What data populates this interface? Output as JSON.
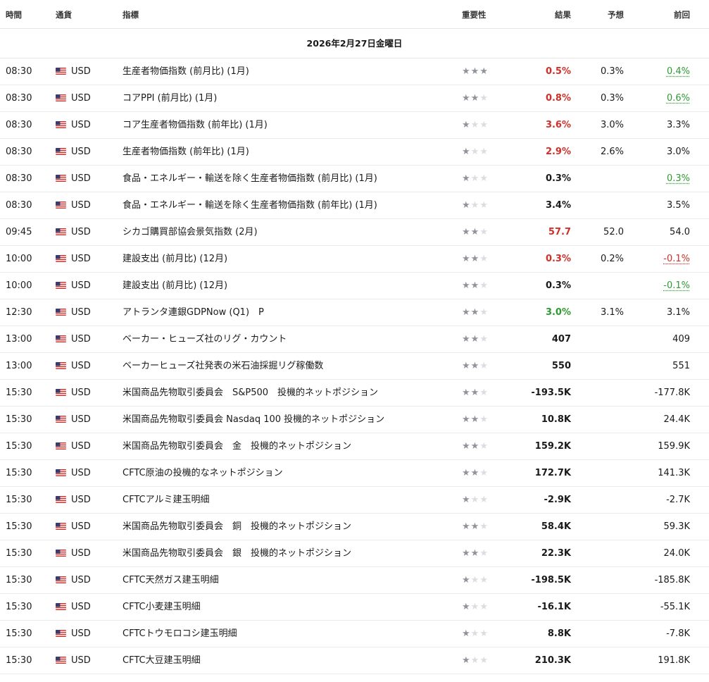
{
  "headers": {
    "time": "時間",
    "currency": "通貨",
    "indicator": "指標",
    "importance": "重要性",
    "actual": "結果",
    "forecast": "予想",
    "previous": "前回"
  },
  "date_label": "2026年2月27日金曜日",
  "colors": {
    "red": "#d0302a",
    "green": "#2e9b31",
    "star_on": "#8f939b",
    "star_off": "#dcdde0"
  },
  "events": [
    {
      "time": "08:30",
      "currency": "USD",
      "indicator": "生産者物価指数 (前月比) (1月)",
      "importance": 3,
      "actual": "0.5%",
      "actual_color": "red",
      "forecast": "0.3%",
      "previous": "0.4%",
      "previous_color": "green"
    },
    {
      "time": "08:30",
      "currency": "USD",
      "indicator": "コアPPI (前月比) (1月)",
      "importance": 2,
      "actual": "0.8%",
      "actual_color": "red",
      "forecast": "0.3%",
      "previous": "0.6%",
      "previous_color": "green"
    },
    {
      "time": "08:30",
      "currency": "USD",
      "indicator": "コア生産者物価指数 (前年比) (1月)",
      "importance": 1,
      "actual": "3.6%",
      "actual_color": "red",
      "forecast": "3.0%",
      "previous": "3.3%",
      "previous_color": ""
    },
    {
      "time": "08:30",
      "currency": "USD",
      "indicator": "生産者物価指数 (前年比) (1月)",
      "importance": 1,
      "actual": "2.9%",
      "actual_color": "red",
      "forecast": "2.6%",
      "previous": "3.0%",
      "previous_color": ""
    },
    {
      "time": "08:30",
      "currency": "USD",
      "indicator": "食品・エネルギー・輸送を除く生産者物価指数 (前月比) (1月)",
      "importance": 1,
      "actual": "0.3%",
      "actual_color": "",
      "forecast": "",
      "previous": "0.3%",
      "previous_color": "green"
    },
    {
      "time": "08:30",
      "currency": "USD",
      "indicator": "食品・エネルギー・輸送を除く生産者物価指数 (前年比) (1月)",
      "importance": 1,
      "actual": "3.4%",
      "actual_color": "",
      "forecast": "",
      "previous": "3.5%",
      "previous_color": ""
    },
    {
      "time": "09:45",
      "currency": "USD",
      "indicator": "シカゴ購買部協会景気指数 (2月)",
      "importance": 2,
      "actual": "57.7",
      "actual_color": "red",
      "forecast": "52.0",
      "previous": "54.0",
      "previous_color": ""
    },
    {
      "time": "10:00",
      "currency": "USD",
      "indicator": "建設支出 (前月比) (12月)",
      "importance": 2,
      "actual": "0.3%",
      "actual_color": "red",
      "forecast": "0.2%",
      "previous": "-0.1%",
      "previous_color": "red"
    },
    {
      "time": "10:00",
      "currency": "USD",
      "indicator": "建設支出 (前月比) (12月)",
      "importance": 2,
      "actual": "0.3%",
      "actual_color": "",
      "forecast": "",
      "previous": "-0.1%",
      "previous_color": "green"
    },
    {
      "time": "12:30",
      "currency": "USD",
      "indicator": "アトランタ連銀GDPNow (Q1)　P",
      "importance": 2,
      "actual": "3.0%",
      "actual_color": "green",
      "forecast": "3.1%",
      "previous": "3.1%",
      "previous_color": ""
    },
    {
      "time": "13:00",
      "currency": "USD",
      "indicator": "ベーカー・ヒューズ社のリグ・カウント",
      "importance": 2,
      "actual": "407",
      "actual_color": "",
      "forecast": "",
      "previous": "409",
      "previous_color": ""
    },
    {
      "time": "13:00",
      "currency": "USD",
      "indicator": "ベーカーヒューズ社発表の米石油採掘リグ稼働数",
      "importance": 2,
      "actual": "550",
      "actual_color": "",
      "forecast": "",
      "previous": "551",
      "previous_color": ""
    },
    {
      "time": "15:30",
      "currency": "USD",
      "indicator": "米国商品先物取引委員会　S&P500　投機的ネットポジション",
      "importance": 2,
      "actual": "-193.5K",
      "actual_color": "",
      "forecast": "",
      "previous": "-177.8K",
      "previous_color": ""
    },
    {
      "time": "15:30",
      "currency": "USD",
      "indicator": "米国商品先物取引委員会 Nasdaq 100 投機的ネットポジション",
      "importance": 2,
      "actual": "10.8K",
      "actual_color": "",
      "forecast": "",
      "previous": "24.4K",
      "previous_color": ""
    },
    {
      "time": "15:30",
      "currency": "USD",
      "indicator": "米国商品先物取引委員会　金　投機的ネットポジション",
      "importance": 2,
      "actual": "159.2K",
      "actual_color": "",
      "forecast": "",
      "previous": "159.9K",
      "previous_color": ""
    },
    {
      "time": "15:30",
      "currency": "USD",
      "indicator": "CFTC原油の投機的なネットポジション",
      "importance": 2,
      "actual": "172.7K",
      "actual_color": "",
      "forecast": "",
      "previous": "141.3K",
      "previous_color": ""
    },
    {
      "time": "15:30",
      "currency": "USD",
      "indicator": "CFTCアルミ建玉明細",
      "importance": 1,
      "actual": "-2.9K",
      "actual_color": "",
      "forecast": "",
      "previous": "-2.7K",
      "previous_color": ""
    },
    {
      "time": "15:30",
      "currency": "USD",
      "indicator": "米国商品先物取引委員会　銅　投機的ネットポジション",
      "importance": 2,
      "actual": "58.4K",
      "actual_color": "",
      "forecast": "",
      "previous": "59.3K",
      "previous_color": ""
    },
    {
      "time": "15:30",
      "currency": "USD",
      "indicator": "米国商品先物取引委員会　銀　投機的ネットポジション",
      "importance": 2,
      "actual": "22.3K",
      "actual_color": "",
      "forecast": "",
      "previous": "24.0K",
      "previous_color": ""
    },
    {
      "time": "15:30",
      "currency": "USD",
      "indicator": "CFTC天然ガス建玉明細",
      "importance": 1,
      "actual": "-198.5K",
      "actual_color": "",
      "forecast": "",
      "previous": "-185.8K",
      "previous_color": ""
    },
    {
      "time": "15:30",
      "currency": "USD",
      "indicator": "CFTC小麦建玉明細",
      "importance": 1,
      "actual": "-16.1K",
      "actual_color": "",
      "forecast": "",
      "previous": "-55.1K",
      "previous_color": ""
    },
    {
      "time": "15:30",
      "currency": "USD",
      "indicator": "CFTCトウモロコシ建玉明細",
      "importance": 1,
      "actual": "8.8K",
      "actual_color": "",
      "forecast": "",
      "previous": "-7.8K",
      "previous_color": ""
    },
    {
      "time": "15:30",
      "currency": "USD",
      "indicator": "CFTC大豆建玉明細",
      "importance": 1,
      "actual": "210.3K",
      "actual_color": "",
      "forecast": "",
      "previous": "191.8K",
      "previous_color": ""
    }
  ]
}
